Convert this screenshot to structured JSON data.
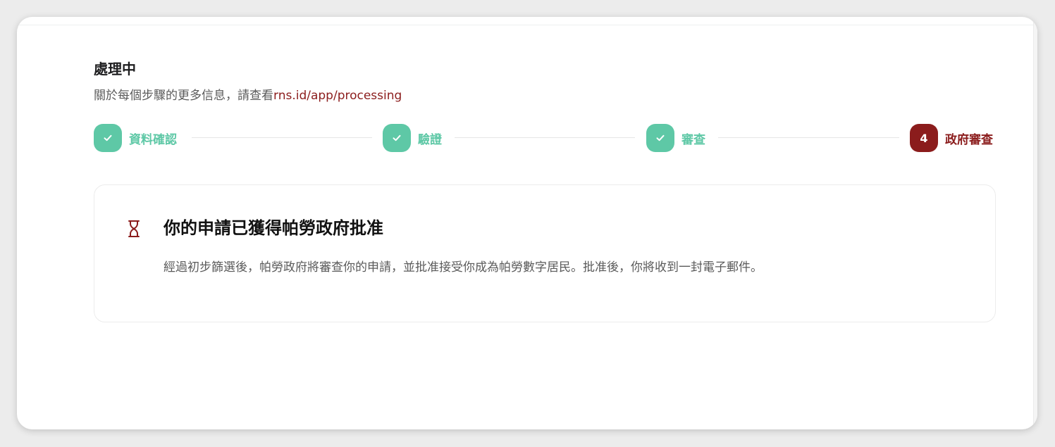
{
  "header": {
    "title": "處理中",
    "subtitle_text": "關於每個步驟的更多信息，請查看",
    "subtitle_link": "rns.id/app/processing"
  },
  "steps": [
    {
      "label": "資料確認",
      "status": "done",
      "icon": "check-icon"
    },
    {
      "label": "驗證",
      "status": "done",
      "icon": "check-icon"
    },
    {
      "label": "審查",
      "status": "done",
      "icon": "check-icon"
    },
    {
      "label": "政府審查",
      "status": "active",
      "number": "4"
    }
  ],
  "notice": {
    "icon": "hourglass-icon",
    "title": "你的申請已獲得帕勞政府批准",
    "body": "經過初步篩選後，帕勞政府將審查你的申請，並批准接受你成為帕勞數字居民。批准後，你將收到一封電子郵件。"
  },
  "colors": {
    "done": "#5ec8a6",
    "active": "#8b1c1c",
    "link": "#8b1c1c"
  }
}
